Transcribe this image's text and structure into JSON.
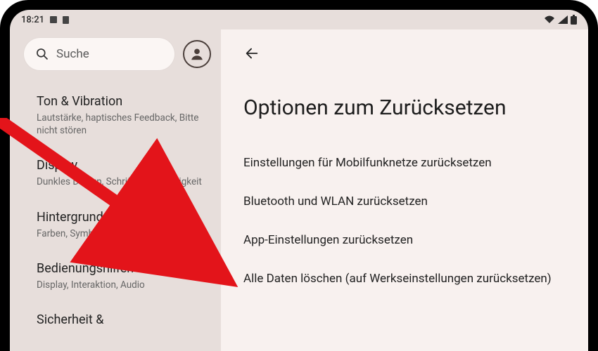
{
  "status_bar": {
    "time": "18:21"
  },
  "sidebar": {
    "search": {
      "placeholder": "Suche"
    },
    "items": [
      {
        "title": "Ton & Vibration",
        "subtitle": "Lautstärke, haptisches Feedback, Bitte nicht stören"
      },
      {
        "title": "Display",
        "subtitle": "Dunkles Design, Schriftgröße, Helligkeit"
      },
      {
        "title": "Hintergrund und Stil",
        "subtitle": "Farben, Symboldesigns, App-Raster"
      },
      {
        "title": "Bedienungshilfen",
        "subtitle": "Display, Interaktion, Audio"
      },
      {
        "title": "Sicherheit &",
        "subtitle": ""
      }
    ]
  },
  "main": {
    "page_title": "Optionen zum Zurücksetzen",
    "options": [
      "Einstellungen für Mobilfunknetze zurücksetzen",
      "Bluetooth und WLAN zurücksetzen",
      "App-Einstellungen zurücksetzen",
      "Alle Daten löschen (auf Werkseinstellungen zurücksetzen)"
    ]
  },
  "annotation": {
    "arrow_color": "#e3141a"
  }
}
